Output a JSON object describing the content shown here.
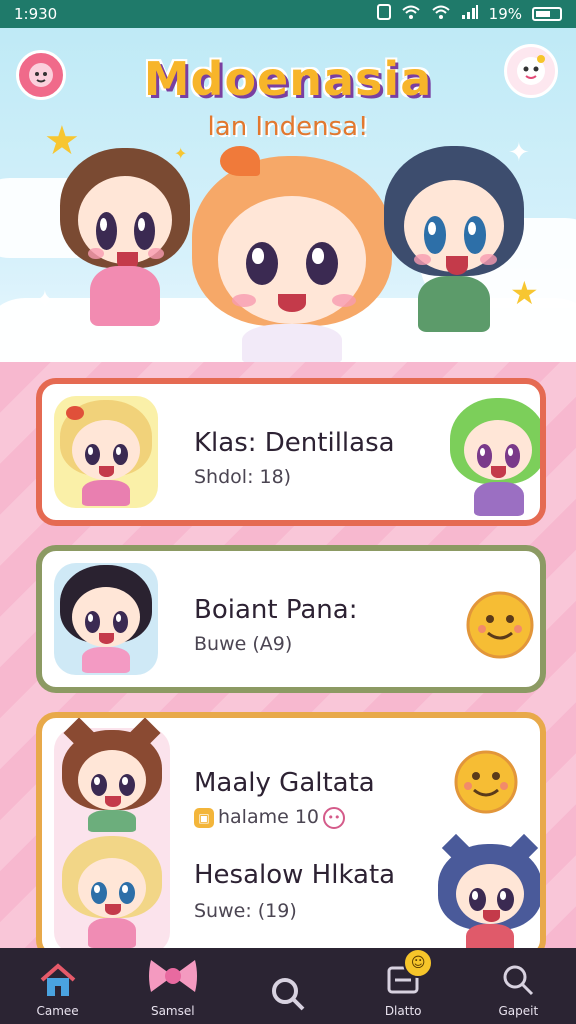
{
  "status_bar": {
    "time": "1:930",
    "battery_text": "19%"
  },
  "hero": {
    "title": "Mdoenasia",
    "subtitle": "lan Indensa!"
  },
  "cards": [
    {
      "title": "Klas: Dentillasa",
      "subtitle": "Shdol: 18)"
    },
    {
      "title": "Boiant Pana:",
      "subtitle": "Buwe (A9)"
    },
    {
      "title": "Maaly Galtata",
      "subtitle": "halame 10"
    },
    {
      "title": "Hesalow Hlkata",
      "subtitle": "Suwe: (19)"
    }
  ],
  "nav": [
    {
      "label": "Camee",
      "icon": "home-icon"
    },
    {
      "label": "Samsel",
      "icon": "bow-icon"
    },
    {
      "label": "",
      "icon": "search-icon"
    },
    {
      "label": "Dlatto",
      "icon": "inbox-icon"
    },
    {
      "label": "Gapeit",
      "icon": "search-icon"
    }
  ],
  "colors": {
    "accent": "#f7b52a",
    "title_shadow": "#7a3fa1",
    "nav_bg": "#2b2433",
    "card1_border": "#e56a52",
    "card2_border": "#8c9a63",
    "card3_border": "#e8a94a"
  }
}
